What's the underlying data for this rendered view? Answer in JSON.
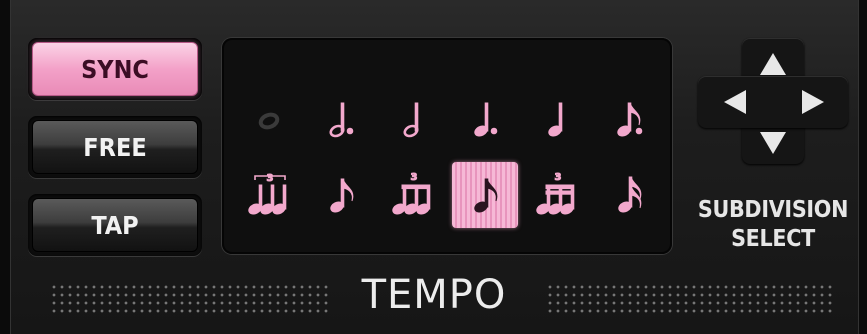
{
  "mode_buttons": [
    {
      "label": "SYNC",
      "active": true
    },
    {
      "label": "FREE",
      "active": false
    },
    {
      "label": "TAP",
      "active": false
    }
  ],
  "subdivisions": [
    {
      "icon": "whole-note-icon",
      "enabled": false,
      "selected": false
    },
    {
      "icon": "dotted-half-note-icon",
      "enabled": true,
      "selected": false
    },
    {
      "icon": "half-note-icon",
      "enabled": true,
      "selected": false
    },
    {
      "icon": "dotted-quarter-note-icon",
      "enabled": true,
      "selected": false
    },
    {
      "icon": "quarter-note-icon",
      "enabled": true,
      "selected": false
    },
    {
      "icon": "dotted-eighth-note-icon",
      "enabled": true,
      "selected": false
    },
    {
      "icon": "quarter-triplet-icon",
      "enabled": true,
      "selected": false,
      "tuplet": "3"
    },
    {
      "icon": "eighth-note-icon",
      "enabled": true,
      "selected": false
    },
    {
      "icon": "eighth-triplet-icon",
      "enabled": true,
      "selected": false,
      "tuplet": "3"
    },
    {
      "icon": "eighth-note-icon",
      "enabled": true,
      "selected": true
    },
    {
      "icon": "sixteenth-triplet-icon",
      "enabled": true,
      "selected": false,
      "tuplet": "3"
    },
    {
      "icon": "sixteenth-note-icon",
      "enabled": true,
      "selected": false
    }
  ],
  "subdivision_select": {
    "label_line1": "SUBDIVISION",
    "label_line2": "SELECT"
  },
  "section_title": "TEMPO",
  "colors": {
    "accent_pink": "#f3a1c8",
    "note_pink": "#f2a8cc",
    "note_disabled": "#3a3a3a",
    "arrow_white": "#e8e8e8"
  }
}
